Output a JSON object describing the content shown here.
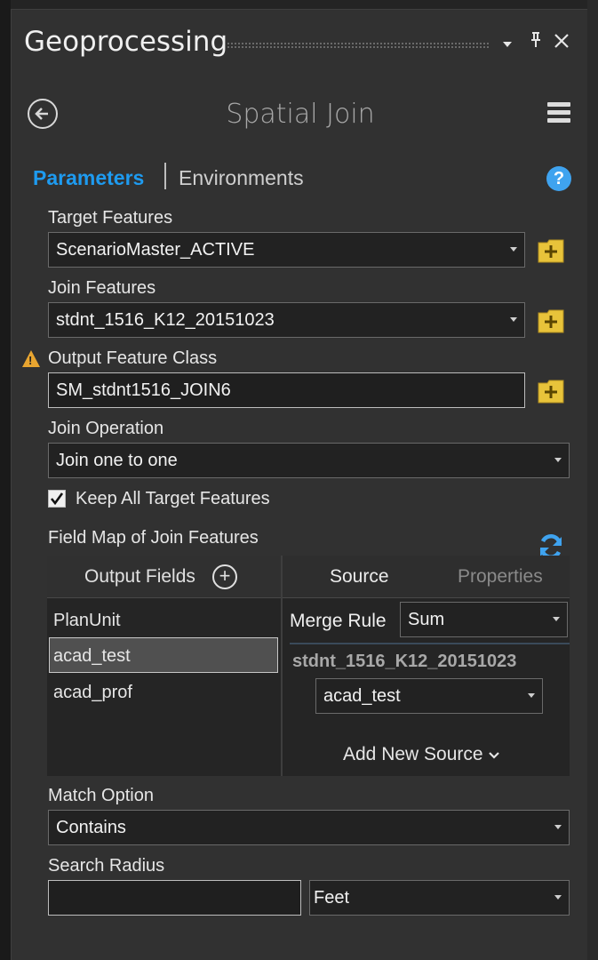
{
  "window": {
    "title": "Geoprocessing",
    "icons": [
      "chevron-down-icon",
      "pin-icon",
      "close-icon"
    ]
  },
  "tool": {
    "title": "Spatial Join",
    "back_icon": "back-arrow-icon",
    "menu_icon": "hamburger-icon",
    "help_icon": "help-icon",
    "help_glyph": "?"
  },
  "tabs": {
    "parameters": "Parameters",
    "environments": "Environments"
  },
  "params": {
    "target_label": "Target Features",
    "target_value": "ScenarioMaster_ACTIVE",
    "join_label": "Join Features",
    "join_value": "stdnt_1516_K12_20151023",
    "output_label": "Output Feature Class",
    "output_value": "SM_stdnt1516_JOIN6",
    "operation_label": "Join Operation",
    "operation_value": "Join one to one",
    "keep_all_label": "Keep All Target Features",
    "keep_all_checked": true,
    "fieldmap_label": "Field Map of Join Features",
    "match_label": "Match Option",
    "match_value": "Contains",
    "radius_label": "Search Radius",
    "radius_value": "",
    "radius_unit": "Feet"
  },
  "field_map": {
    "output_fields_label": "Output Fields",
    "tab_source": "Source",
    "tab_properties": "Properties",
    "fields": [
      "PlanUnit",
      "acad_test",
      "acad_prof"
    ],
    "selected_field": "acad_test",
    "merge_rule_label": "Merge Rule",
    "merge_rule_value": "Sum",
    "source_name": "stdnt_1516_K12_20151023",
    "source_field": "acad_test",
    "add_new_source": "Add New Source"
  },
  "colors": {
    "accent": "#1e9bf0",
    "background": "#313131",
    "warning": "#e8a530",
    "browse_folder": "#e8c33a"
  }
}
